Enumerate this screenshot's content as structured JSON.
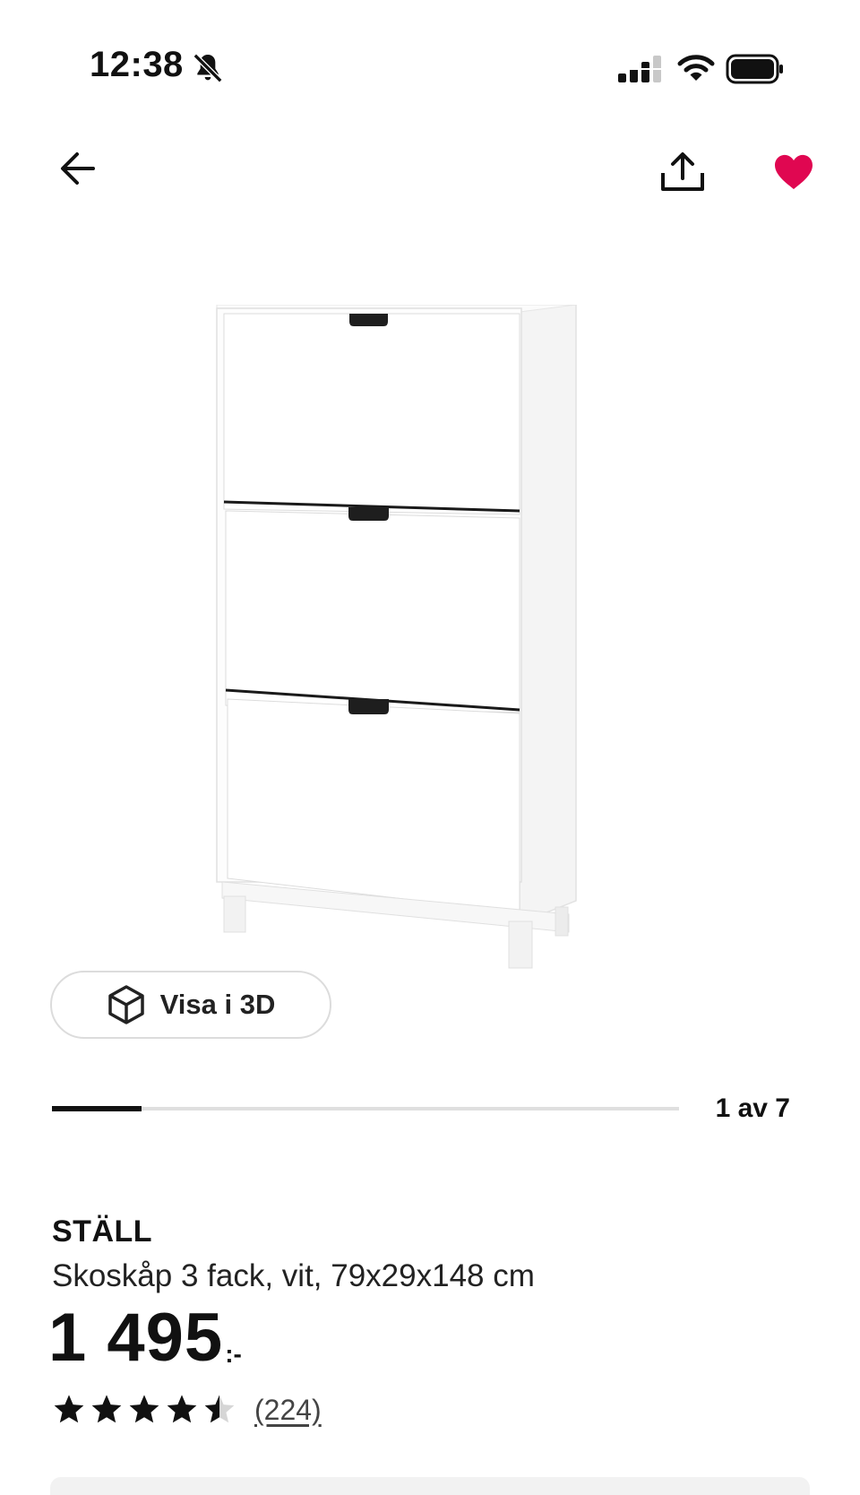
{
  "status_bar": {
    "time": "12:38",
    "icons": [
      "bell-off-icon",
      "signal-icon",
      "wifi-icon",
      "battery-icon"
    ]
  },
  "nav": {
    "icons": [
      "arrow-left-icon",
      "share-icon",
      "heart-icon"
    ],
    "favorite_active": true,
    "favorite_color": "#E00751"
  },
  "gallery": {
    "view_3d_label": "Visa i 3D",
    "view_3d_icon": "cube-icon",
    "position_label": "1 av 7",
    "current": 1,
    "total": 7
  },
  "product": {
    "name": "STÄLL",
    "description": "Skoskåp 3 fack, vit, 79x29x148 cm",
    "price_integer": "1 495",
    "price_suffix": ":-",
    "rating": 4.5,
    "review_count": "(224)"
  }
}
